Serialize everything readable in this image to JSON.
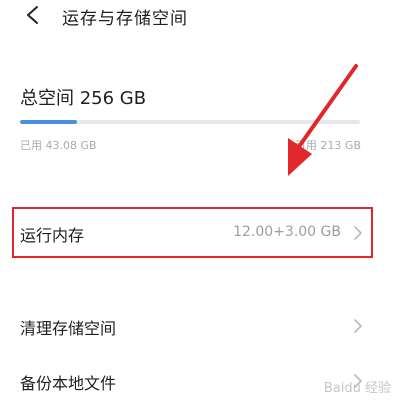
{
  "header": {
    "back_icon": "chevron-left-icon",
    "title": "运存与存储空间"
  },
  "storage": {
    "total_label": "总空间 256 GB",
    "used_label": "已用 43.08 GB",
    "available_label": "可用 213 GB",
    "used_fraction": 0.168,
    "bar_color": "#4a90e2"
  },
  "rows": [
    {
      "label": "运行内存",
      "value": "12.00+3.00 GB",
      "icon": "chevron-right-icon"
    },
    {
      "label": "清理存储空间",
      "value": "",
      "icon": "chevron-right-icon"
    },
    {
      "label": "备份本地文件",
      "value": "",
      "icon": "chevron-right-icon"
    }
  ],
  "annotation": {
    "highlight_color": "#e0272b"
  },
  "watermark": {
    "text": "Baidu 经验"
  }
}
